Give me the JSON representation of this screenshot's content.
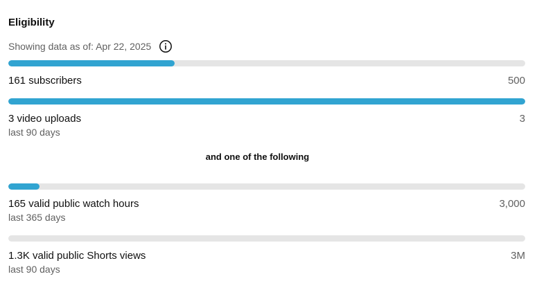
{
  "title": "Eligibility",
  "as_of": "Showing data as of: Apr 22, 2025",
  "icons": {
    "info": "info-circle-icon"
  },
  "colors": {
    "fill": "#31a4d1",
    "track": "#e5e5e5"
  },
  "or_text": "and one of the following",
  "metrics": [
    {
      "label": "161 subscribers",
      "goal": "500",
      "sublabel": "",
      "progress": 0.322
    },
    {
      "label": "3 video uploads",
      "goal": "3",
      "sublabel": "last 90 days",
      "progress": 1.0
    },
    {
      "label": "165 valid public watch hours",
      "goal": "3,000",
      "sublabel": "last 365 days",
      "progress": 0.06
    },
    {
      "label": "1.3K valid public Shorts views",
      "goal": "3M",
      "sublabel": "last 90 days",
      "progress": 0.0
    }
  ]
}
